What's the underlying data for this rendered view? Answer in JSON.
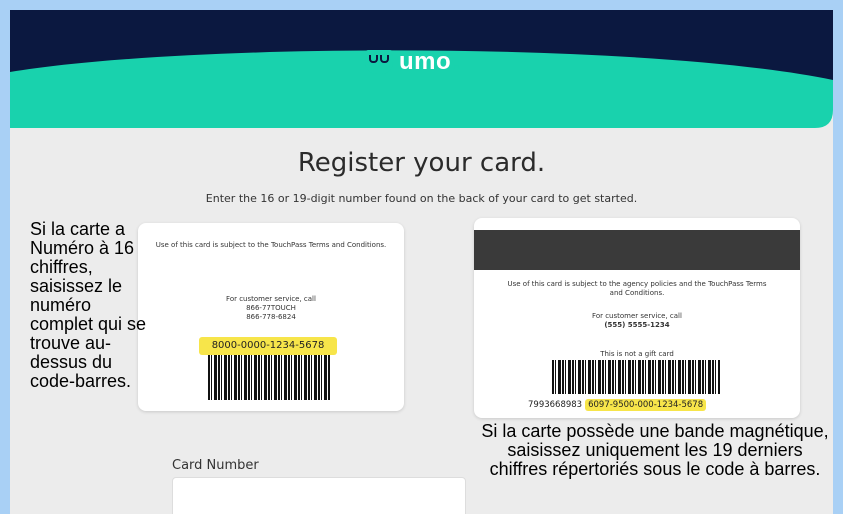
{
  "brand": {
    "name": "umo",
    "dot": "."
  },
  "page": {
    "title": "Register your card.",
    "subtitle": "Enter the 16 or 19-digit number found on the back of your card to get started."
  },
  "card16": {
    "terms": "Use of this card is subject to the TouchPass Terms and Conditions.",
    "service_label": "For customer service, call",
    "phone1": "866-77TOUCH",
    "phone2": "866-778-6824",
    "number": "8000-0000-1234-5678"
  },
  "card19": {
    "terms": "Use of this card is subject to the agency policies and the TouchPass Terms and Conditions.",
    "service_label": "For customer service, call",
    "phone": "(555) 5555-1234",
    "gift_note": "This is not a gift card",
    "prefix": "7993668983",
    "number": "6097-9500-000-1234-5678"
  },
  "annotations": {
    "left": "Si la carte a Numéro à 16 chiffres, saisissez le numéro complet qui se trouve au-dessus du code-barres.",
    "right": "Si la carte possède une bande magnétique, saisissez uniquement les 19 derniers chiffres répertoriés sous le code à barres."
  },
  "form": {
    "card_number_label": "Card Number",
    "card_number_value": ""
  },
  "colors": {
    "header_navy": "#0b1840",
    "header_teal": "#19d2ad",
    "highlight": "#f7e54a",
    "outer_border": "#a9d0f5"
  }
}
